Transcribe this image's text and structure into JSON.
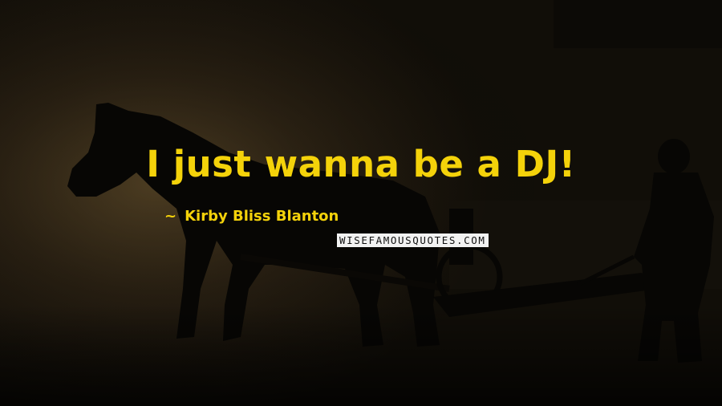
{
  "colors": {
    "quote": "#f4d20a",
    "author": "#f4d20a",
    "silhouette": "#070604",
    "background": "#0d0b07"
  },
  "quote": {
    "text": "I just wanna be a DJ!"
  },
  "author": {
    "dash": "~",
    "name": "Kirby Bliss Blanton"
  },
  "watermark": {
    "text": "WISEFAMOUSQUOTES.COM"
  }
}
